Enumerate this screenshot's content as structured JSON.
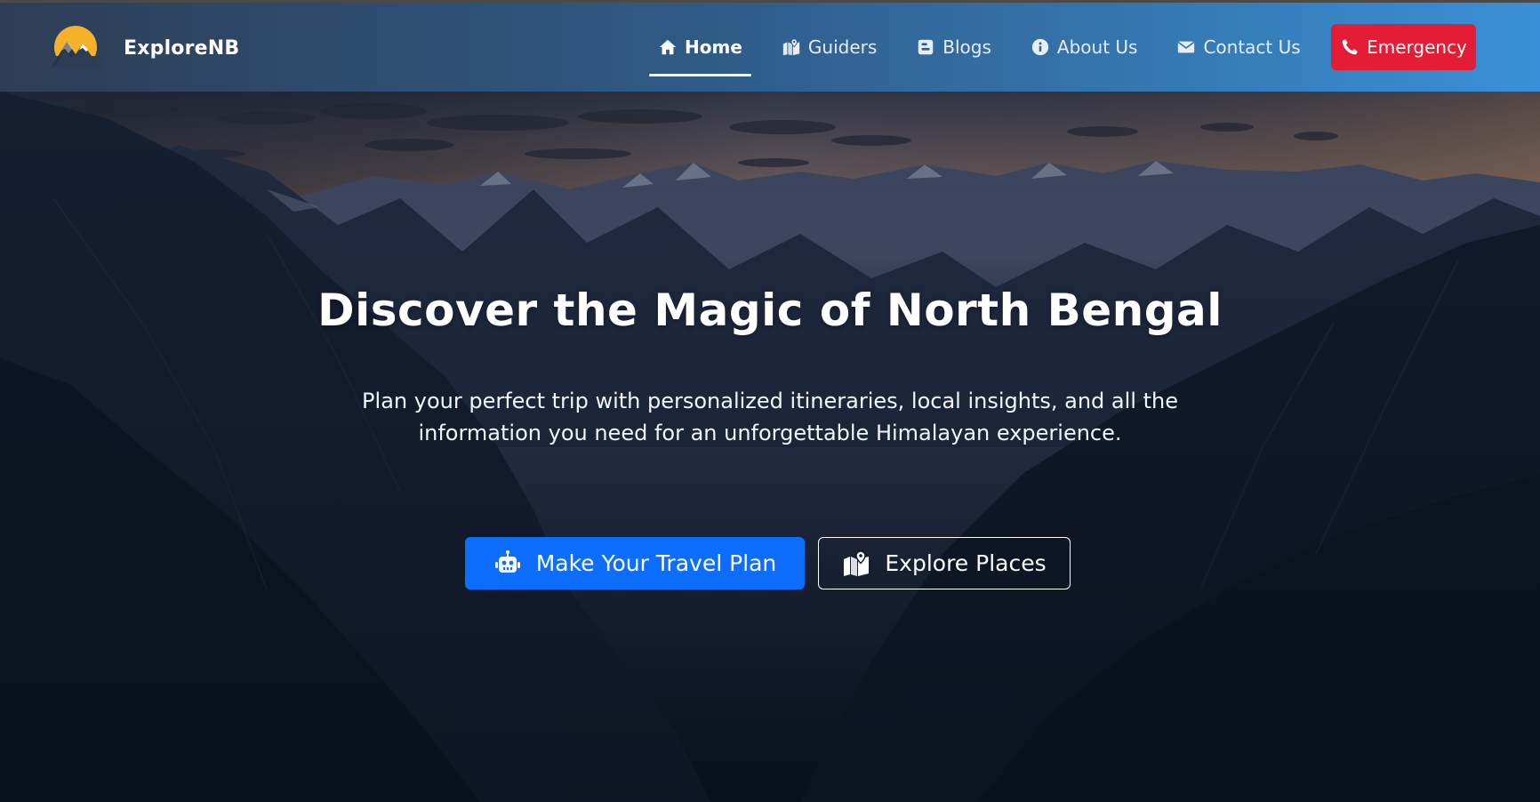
{
  "brand": {
    "name": "ExploreNB",
    "logo_icon": "mountain-sun-logo"
  },
  "nav": {
    "items": [
      {
        "label": "Home",
        "icon": "home-icon",
        "active": true
      },
      {
        "label": "Guiders",
        "icon": "map-location-icon",
        "active": false
      },
      {
        "label": "Blogs",
        "icon": "blogger-icon",
        "active": false
      },
      {
        "label": "About Us",
        "icon": "info-circle-icon",
        "active": false
      },
      {
        "label": "Contact Us",
        "icon": "envelope-icon",
        "active": false
      }
    ],
    "emergency": {
      "label": "Emergency",
      "icon": "phone-icon"
    }
  },
  "hero": {
    "title": "Discover the Magic of North Bengal",
    "subtitle": "Plan your perfect trip with personalized itineraries, local insights, and all the information you need for an unforgettable Himalayan experience.",
    "primary_button": {
      "label": "Make Your Travel Plan",
      "icon": "robot-icon"
    },
    "secondary_button": {
      "label": "Explore Places",
      "icon": "map-location-icon"
    }
  },
  "colors": {
    "nav_gradient_start": "#2e3d55",
    "nav_gradient_end": "#3a90d6",
    "emergency": "#e41d36",
    "primary_button": "#0d6efd",
    "logo_sun": "#f5b12a"
  }
}
